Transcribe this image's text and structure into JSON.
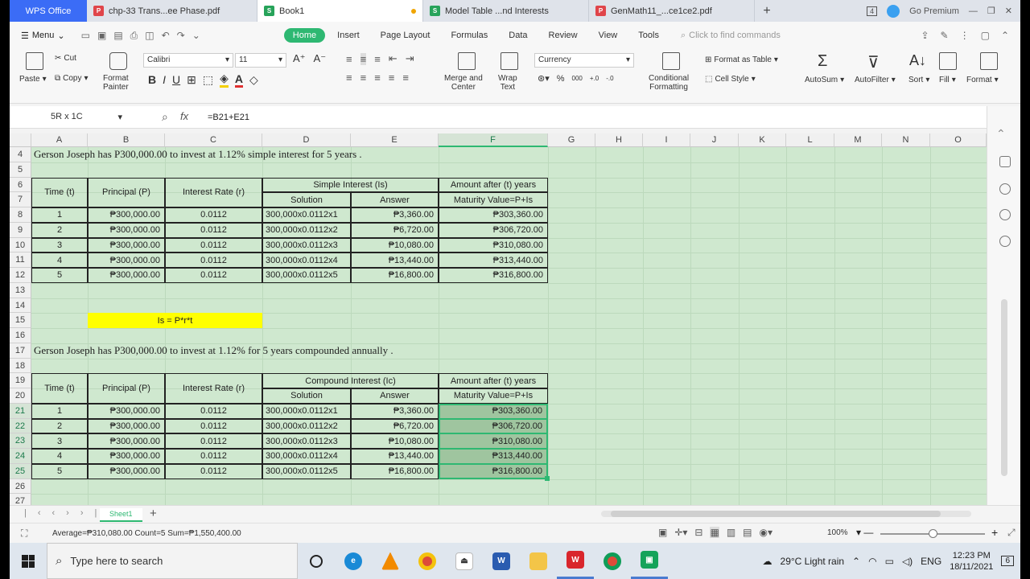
{
  "tabs": {
    "app": "WPS Office",
    "docs": [
      {
        "label": "chp-33 Trans...ee Phase.pdf",
        "kind": "pdf"
      },
      {
        "label": "Book1",
        "kind": "xls",
        "active": true
      },
      {
        "label": "Model Table ...nd Interests",
        "kind": "xls"
      },
      {
        "label": "GenMath11_...ce1ce2.pdf",
        "kind": "pdf"
      }
    ],
    "window_count": "4",
    "premium": "Go Premium"
  },
  "ribbon_tabs": {
    "menu": "Menu",
    "items": [
      "Home",
      "Insert",
      "Page Layout",
      "Formulas",
      "Data",
      "Review",
      "View",
      "Tools"
    ],
    "active": "Home",
    "search_placeholder": "Click to find commands"
  },
  "ribbon": {
    "paste": "Paste",
    "cut": "Cut",
    "copy": "Copy",
    "format_painter_1": "Format",
    "format_painter_2": "Painter",
    "font": "Calibri",
    "size": "11",
    "merge_1": "Merge and",
    "merge_2": "Center",
    "wrap_1": "Wrap",
    "wrap_2": "Text",
    "number_format": "Currency",
    "cond_1": "Conditional",
    "cond_2": "Formatting",
    "format_table": "Format as Table",
    "cell_style": "Cell Style",
    "autosum": "AutoSum",
    "autofilter": "AutoFilter",
    "sort": "Sort",
    "fill": "Fill",
    "format": "Format"
  },
  "formula_bar": {
    "name_box": "5R x 1C",
    "fx": "fx",
    "formula": "=B21+E21"
  },
  "grid": {
    "columns": [
      "A",
      "B",
      "C",
      "D",
      "E",
      "F",
      "G",
      "H",
      "I",
      "J",
      "K",
      "L",
      "M",
      "N",
      "O"
    ],
    "rows": [
      "4",
      "5",
      "6",
      "7",
      "8",
      "9",
      "10",
      "11",
      "12",
      "13",
      "14",
      "15",
      "16",
      "17",
      "18",
      "19",
      "20",
      "21",
      "22",
      "23",
      "24",
      "25",
      "26",
      "27"
    ],
    "title1": "Gerson Joseph has P300,000.00 to invest at 1.12% simple interest for 5 years .",
    "title2": "Gerson Joseph has P300,000.00 to invest at 1.12% for 5 years compounded annually .",
    "formula_note": "Is = P*r*t",
    "table1": {
      "h_time": "Time (t)",
      "h_principal": "Principal (P)",
      "h_rate": "Interest Rate (r)",
      "h_group": "Simple Interest (Is)",
      "h_solution": "Solution",
      "h_answer": "Answer",
      "h_amount": "Amount after (t) years",
      "h_maturity": "Maturity Value=P+Is",
      "rows": [
        [
          "1",
          "₱300,000.00",
          "0.0112",
          "300,000x0.0112x1",
          "₱3,360.00",
          "₱303,360.00"
        ],
        [
          "2",
          "₱300,000.00",
          "0.0112",
          "300,000x0.0112x2",
          "₱6,720.00",
          "₱306,720.00"
        ],
        [
          "3",
          "₱300,000.00",
          "0.0112",
          "300,000x0.0112x3",
          "₱10,080.00",
          "₱310,080.00"
        ],
        [
          "4",
          "₱300,000.00",
          "0.0112",
          "300,000x0.0112x4",
          "₱13,440.00",
          "₱313,440.00"
        ],
        [
          "5",
          "₱300,000.00",
          "0.0112",
          "300,000x0.0112x5",
          "₱16,800.00",
          "₱316,800.00"
        ]
      ]
    },
    "table2": {
      "h_time": "Time (t)",
      "h_principal": "Principal (P)",
      "h_rate": "Interest Rate (r)",
      "h_group": "Compound Interest (Ic)",
      "h_solution": "Solution",
      "h_answer": "Answer",
      "h_amount": "Amount after (t) years",
      "h_maturity": "Maturity Value=P+Is",
      "rows": [
        [
          "1",
          "₱300,000.00",
          "0.0112",
          "300,000x0.0112x1",
          "₱3,360.00",
          "₱303,360.00"
        ],
        [
          "2",
          "₱300,000.00",
          "0.0112",
          "300,000x0.0112x2",
          "₱6,720.00",
          "₱306,720.00"
        ],
        [
          "3",
          "₱300,000.00",
          "0.0112",
          "300,000x0.0112x3",
          "₱10,080.00",
          "₱310,080.00"
        ],
        [
          "4",
          "₱300,000.00",
          "0.0112",
          "300,000x0.0112x4",
          "₱13,440.00",
          "₱313,440.00"
        ],
        [
          "5",
          "₱300,000.00",
          "0.0112",
          "300,000x0.0112x5",
          "₱16,800.00",
          "₱316,800.00"
        ]
      ]
    }
  },
  "sheets": {
    "active": "Sheet1"
  },
  "status": {
    "summary": "Average=₱310,080.00  Count=5  Sum=₱1,550,400.00",
    "zoom": "100%"
  },
  "taskbar": {
    "search_placeholder": "Type here to search",
    "weather": "29°C  Light rain",
    "lang": "ENG",
    "time": "12:23 PM",
    "date": "18/11/2021",
    "notif_count": "6"
  },
  "colors": {
    "accent": "#2eb872",
    "selection": "#9fc59f",
    "sheet_bg": "#cfe8cf",
    "note_bg": "#ffff00"
  }
}
